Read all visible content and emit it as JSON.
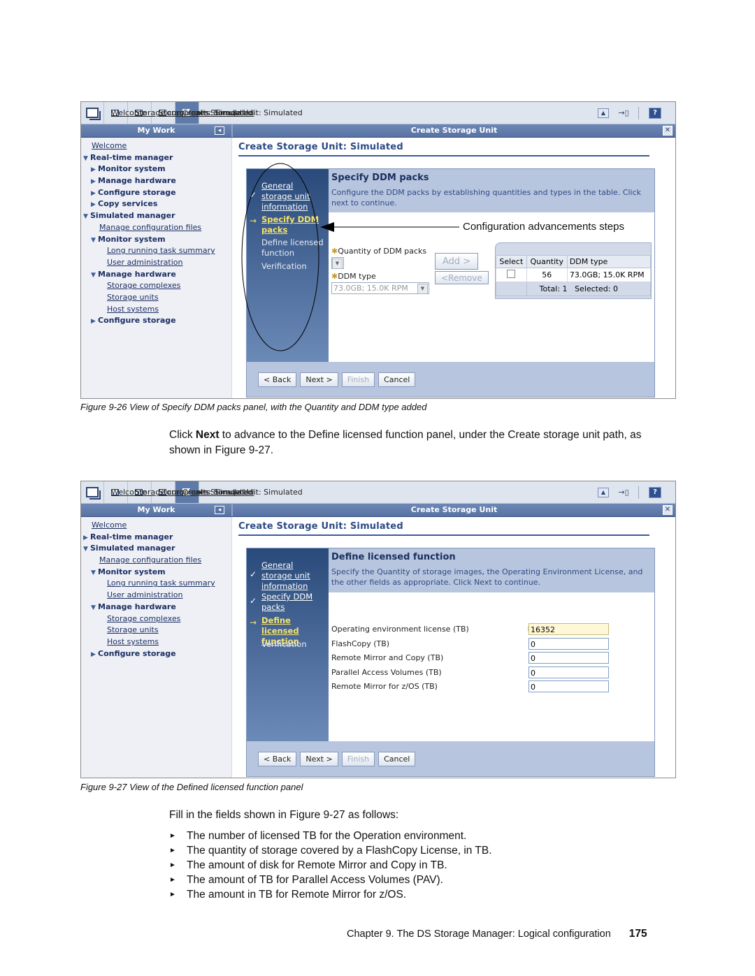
{
  "figure1": {
    "tabs": [
      "Welcome",
      "Storage complexes: Simulated",
      "Storage units: Simulated",
      "Create Storage Unit: Simulated"
    ],
    "my_work_title": "My Work",
    "panel_title": "Create Storage Unit",
    "nav": [
      {
        "label": "Welcome",
        "style": "link",
        "indent": 0,
        "icon": "none"
      },
      {
        "label": "Real-time manager",
        "style": "bold",
        "indent": 0,
        "icon": "expanded"
      },
      {
        "label": "Monitor system",
        "style": "bold",
        "indent": 1,
        "icon": "collapsed"
      },
      {
        "label": "Manage hardware",
        "style": "bold",
        "indent": 1,
        "icon": "collapsed"
      },
      {
        "label": "Configure storage",
        "style": "bold",
        "indent": 1,
        "icon": "collapsed"
      },
      {
        "label": "Copy services",
        "style": "bold",
        "indent": 1,
        "icon": "collapsed"
      },
      {
        "label": "Simulated manager",
        "style": "bold",
        "indent": 0,
        "icon": "expanded"
      },
      {
        "label": "Manage configuration files",
        "style": "link",
        "indent": 1,
        "icon": "none"
      },
      {
        "label": "Monitor system",
        "style": "bold",
        "indent": 1,
        "icon": "expanded"
      },
      {
        "label": "Long running task summary",
        "style": "link",
        "indent": 2,
        "icon": "none"
      },
      {
        "label": "User administration",
        "style": "link",
        "indent": 2,
        "icon": "none"
      },
      {
        "label": "Manage hardware",
        "style": "bold",
        "indent": 1,
        "icon": "expanded"
      },
      {
        "label": "Storage complexes",
        "style": "link",
        "indent": 2,
        "icon": "none"
      },
      {
        "label": "Storage units",
        "style": "link",
        "indent": 2,
        "icon": "none"
      },
      {
        "label": "Host systems",
        "style": "link",
        "indent": 2,
        "icon": "none"
      },
      {
        "label": "Configure storage",
        "style": "bold",
        "indent": 1,
        "icon": "collapsed"
      }
    ],
    "content_title": "Create Storage Unit: Simulated",
    "steps": {
      "s1": "General storage unit information",
      "s1a": "General",
      "s1b": "storage unit",
      "s1c": "information",
      "s2a": "Specify DDM",
      "s2b": "packs",
      "s3a": "Define licensed",
      "s3b": "function",
      "s4": "Verification"
    },
    "wizard_heading": "Specify DDM packs",
    "wizard_desc": "Configure the DDM packs by establishing quantities and types in the table. Click next to continue.",
    "callout": "Configuration advancements steps",
    "qty_label": "Quantity of DDM packs",
    "ddm_type_label": "DDM type",
    "ddm_type_value": "73.0GB; 15.0K RPM",
    "add_button": "Add >",
    "remove_button": "<Remove",
    "table": {
      "headers": [
        "Select",
        "Quantity",
        "DDM type"
      ],
      "rows": [
        {
          "quantity": "56",
          "ddm_type": "73.0GB; 15.0K RPM"
        }
      ],
      "total": "Total: 1",
      "selected": "Selected: 0"
    },
    "buttons": {
      "back": "< Back",
      "next": "Next >",
      "finish": "Finish",
      "cancel": "Cancel"
    },
    "caption": "Figure 9-26   View of Specify DDM packs panel, with the Quantity and DDM type added"
  },
  "paragraph1": {
    "pre": "Click ",
    "bold": "Next",
    "post": " to advance to the Define licensed function panel, under the Create storage unit path, as shown in Figure 9-27."
  },
  "figure2": {
    "tabs": [
      "Welcome",
      "Storage complexes: Simulated",
      "Storage units: Simulated",
      "Create Storage Unit: Simulated"
    ],
    "my_work_title": "My Work",
    "panel_title": "Create Storage Unit",
    "nav": [
      {
        "label": "Welcome",
        "style": "link",
        "indent": 0,
        "icon": "none"
      },
      {
        "label": "Real-time manager",
        "style": "bold",
        "indent": 0,
        "icon": "collapsed"
      },
      {
        "label": "Simulated manager",
        "style": "bold",
        "indent": 0,
        "icon": "expanded"
      },
      {
        "label": "Manage configuration files",
        "style": "link",
        "indent": 1,
        "icon": "none"
      },
      {
        "label": "Monitor system",
        "style": "bold",
        "indent": 1,
        "icon": "expanded"
      },
      {
        "label": "Long running task summary",
        "style": "link",
        "indent": 2,
        "icon": "none"
      },
      {
        "label": "User administration",
        "style": "link",
        "indent": 2,
        "icon": "none"
      },
      {
        "label": "Manage hardware",
        "style": "bold",
        "indent": 1,
        "icon": "expanded"
      },
      {
        "label": "Storage complexes",
        "style": "link",
        "indent": 2,
        "icon": "none"
      },
      {
        "label": "Storage units",
        "style": "link",
        "indent": 2,
        "icon": "none"
      },
      {
        "label": "Host systems",
        "style": "link",
        "indent": 2,
        "icon": "none"
      },
      {
        "label": "Configure storage",
        "style": "bold",
        "indent": 1,
        "icon": "collapsed"
      }
    ],
    "content_title": "Create Storage Unit: Simulated",
    "steps": {
      "s1a": "General",
      "s1b": "storage unit",
      "s1c": "information",
      "s2a": "Specify DDM",
      "s2b": "packs",
      "s3a": "Define licensed",
      "s3b": "function",
      "s4": "Verification"
    },
    "wizard_heading": "Define licensed function",
    "wizard_desc": "Specify the Quantity of storage images, the Operating Environment License, and the other fields as appropriate. Click Next to continue.",
    "fields": [
      {
        "label": "Operating environment license (TB)",
        "value": "16352",
        "required": true
      },
      {
        "label": "FlashCopy (TB)",
        "value": "0",
        "required": false
      },
      {
        "label": "Remote Mirror and Copy (TB)",
        "value": "0",
        "required": false
      },
      {
        "label": "Parallel Access Volumes (TB)",
        "value": "0",
        "required": false
      },
      {
        "label": "Remote Mirror for z/OS (TB)",
        "value": "0",
        "required": false
      }
    ],
    "buttons": {
      "back": "< Back",
      "next": "Next >",
      "finish": "Finish",
      "cancel": "Cancel"
    },
    "caption": "Figure 9-27   View of the Defined licensed function panel"
  },
  "paragraph2": "Fill in the fields shown in Figure 9-27 as follows:",
  "bullets": [
    "The number of licensed TB for the Operation environment.",
    "The quantity of storage covered by a FlashCopy License, in TB.",
    "The amount of disk for Remote Mirror and Copy in TB.",
    "The amount of TB for Parallel Access Volumes (PAV).",
    "The amount in TB for Remote Mirror for z/OS."
  ],
  "footer": {
    "chapter": "Chapter 9. The DS Storage Manager: Logical configuration",
    "page": "175"
  }
}
